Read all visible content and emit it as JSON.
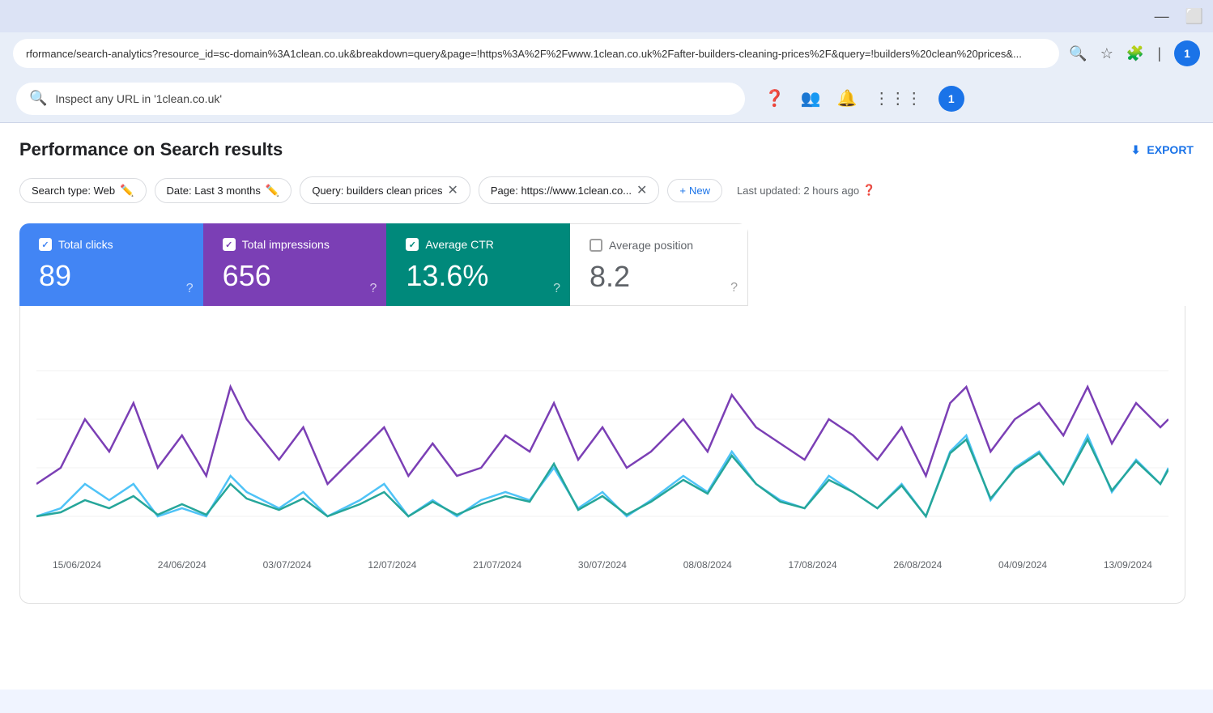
{
  "browser": {
    "url": "rformance/search-analytics?resource_id=sc-domain%3A1clean.co.uk&breakdown=query&page=!https%3A%2F%2Fwww.1clean.co.uk%2Fafter-builders-cleaning-prices%2F&query=!builders%20clean%20prices&...",
    "avatar_initial": "1"
  },
  "toolbar": {
    "search_placeholder": "Inspect any URL in '1clean.co.uk'"
  },
  "header": {
    "title": "Performance on Search results",
    "export_label": "EXPORT"
  },
  "filters": {
    "search_type_label": "Search type: Web",
    "date_label": "Date: Last 3 months",
    "query_label": "Query: builders clean prices",
    "page_label": "Page: https://www.1clean.co...",
    "new_label": "New",
    "last_updated": "Last updated: 2 hours ago"
  },
  "metrics": {
    "clicks": {
      "label": "Total clicks",
      "value": "89",
      "help": "?"
    },
    "impressions": {
      "label": "Total impressions",
      "value": "656",
      "help": "?"
    },
    "ctr": {
      "label": "Average CTR",
      "value": "13.6%",
      "help": "?"
    },
    "position": {
      "label": "Average position",
      "value": "8.2",
      "help": "?"
    }
  },
  "chart": {
    "x_labels": [
      "15/06/2024",
      "24/06/2024",
      "03/07/2024",
      "12/07/2024",
      "21/07/2024",
      "30/07/2024",
      "08/08/2024",
      "17/08/2024",
      "26/08/2024",
      "04/09/2024",
      "13/09/2024"
    ]
  }
}
